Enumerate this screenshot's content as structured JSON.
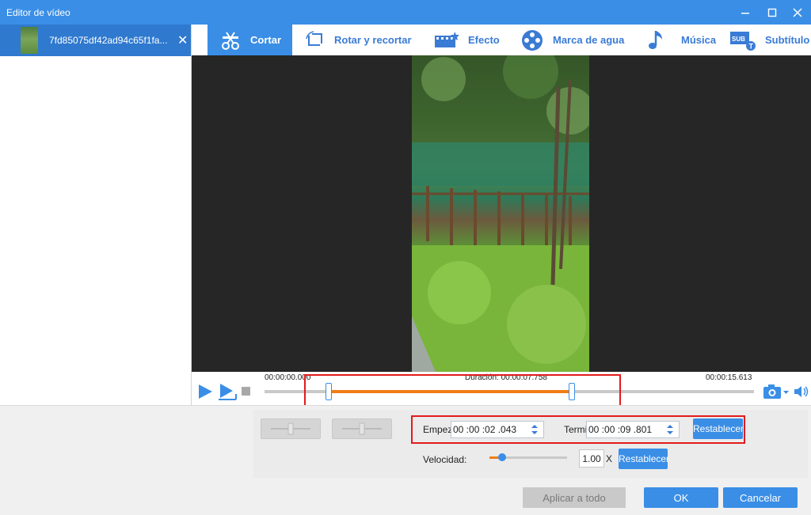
{
  "window": {
    "title": "Editor de vídeo"
  },
  "sidebar": {
    "file_name": "7fd85075df42ad94c65f1fa..."
  },
  "toolbar": {
    "tools": [
      {
        "label": "Cortar",
        "icon": "scissors-icon",
        "active": true
      },
      {
        "label": "Rotar y recortar",
        "icon": "rotate-crop-icon"
      },
      {
        "label": "Efecto",
        "icon": "effect-icon"
      },
      {
        "label": "Marca de agua",
        "icon": "watermark-icon"
      },
      {
        "label": "Música",
        "icon": "music-note-icon"
      },
      {
        "label": "Subtítulo",
        "icon": "subtitle-icon"
      }
    ]
  },
  "timeline": {
    "start_time": "00:00:00.000",
    "duration_label": "Duración",
    "duration_value": "00:00:07.758",
    "end_time": "00:00:15.613",
    "selection_start": 0.1308,
    "selection_end": 0.6277
  },
  "trim": {
    "start_label": "Empezar",
    "start_value": "00 :00 :02 .043",
    "end_label": "Terminar",
    "end_value": "00 :00 :09 .801",
    "reset_label": "Restablecer"
  },
  "speed": {
    "label": "Velocidad:",
    "value": "1.00",
    "unit": "X",
    "level": 0.05,
    "reset_label": "Restablecer"
  },
  "footer": {
    "apply_all": "Aplicar a todo",
    "ok": "OK",
    "cancel": "Cancelar"
  },
  "colors": {
    "accent": "#3a8ee6",
    "progress": "#f07d16",
    "highlight": "#e31b1b"
  }
}
